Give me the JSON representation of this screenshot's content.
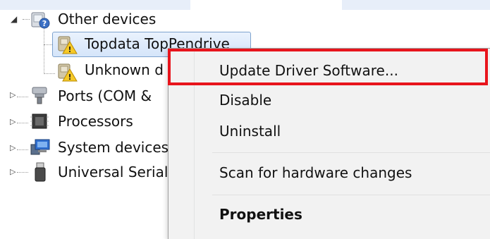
{
  "tree": {
    "items": [
      {
        "label": "Other devices",
        "icon": "unknown-device-category-icon",
        "expanded": true
      },
      {
        "label": "Topdata TopPendrive",
        "icon": "warning-device-icon",
        "selected": true
      },
      {
        "label": "Unknown d",
        "icon": "warning-device-icon"
      },
      {
        "label": "Ports (COM &",
        "icon": "port-icon"
      },
      {
        "label": "Processors",
        "icon": "processor-icon"
      },
      {
        "label": "System devices",
        "icon": "system-device-icon"
      },
      {
        "label": "Universal Serial",
        "icon": "usb-icon"
      }
    ]
  },
  "context_menu": {
    "items": [
      {
        "label": "Update Driver Software...",
        "highlighted": true
      },
      {
        "label": "Disable"
      },
      {
        "label": "Uninstall"
      },
      {
        "label": "Scan for hardware changes"
      },
      {
        "label": "Properties",
        "bold": true
      }
    ]
  },
  "colors": {
    "highlight_border": "#e8141c",
    "selection_border": "#7da2ce",
    "menu_background": "#f2f2f2"
  }
}
